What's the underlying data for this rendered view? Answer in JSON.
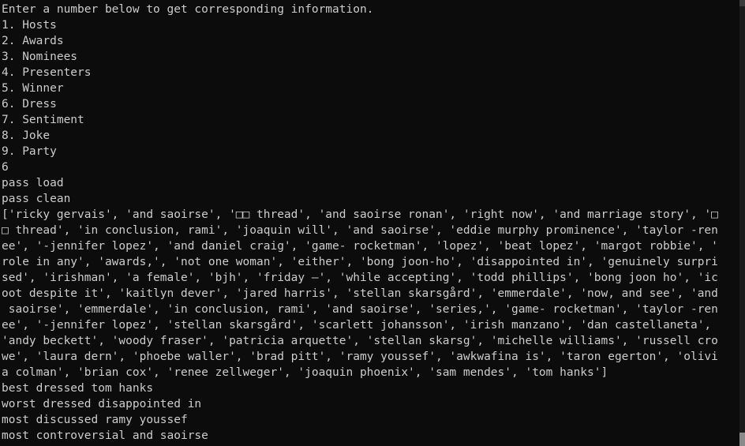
{
  "console": {
    "lines": [
      "Enter a number below to get corresponding information.",
      "1. Hosts",
      "2. Awards",
      "3. Nominees",
      "4. Presenters",
      "5. Winner",
      "6. Dress",
      "7. Sentiment",
      "8. Joke",
      "9. Party",
      "6",
      "pass load",
      "pass clean",
      "['ricky gervais', 'and saoirse', '□□ thread', 'and saoirse ronan', 'right now', 'and marriage story', '□",
      "□ thread', 'in conclusion, rami', 'joaquin will', 'and saoirse', 'eddie murphy prominence', 'taylor -ren",
      "ee', '-jennifer lopez', 'and daniel craig', 'game- rocketman', 'lopez', 'beat lopez', 'margot robbie', '",
      "role in any', 'awards,', 'not one woman', 'either', 'bong joon-ho', 'disappointed in', 'genuinely surpri",
      "sed', 'irishman', 'a female', 'bjh', 'friday —', 'while accepting', 'todd phillips', 'bong joon ho', 'ic",
      "oot despite it', 'kaitlyn dever', 'jared harris', 'stellan skarsgård', 'emmerdale', 'now, and see', 'and",
      " saoirse', 'emmerdale', 'in conclusion, rami', 'and saoirse', 'series,', 'game- rocketman', 'taylor -ren",
      "ee', '-jennifer lopez', 'stellan skarsgård', 'scarlett johansson', 'irish manzano', 'dan castellaneta',",
      "'andy beckett', 'woody fraser', 'patricia arquette', 'stellan skarsg', 'michelle williams', 'russell cro",
      "we', 'laura dern', 'phoebe waller', 'brad pitt', 'ramy youssef', 'awkwafina is', 'taron egerton', 'olivi",
      "a colman', 'brian cox', 'renee zellweger', 'joaquin phoenix', 'sam mendes', 'tom hanks']",
      "best dressed tom hanks",
      "worst dressed disappointed in",
      "most discussed ramy youssef",
      "most controversial and saoirse"
    ]
  },
  "scrollbar": {
    "thumb_start_fraction": 0.97,
    "thumb_size_fraction": 0.03
  }
}
